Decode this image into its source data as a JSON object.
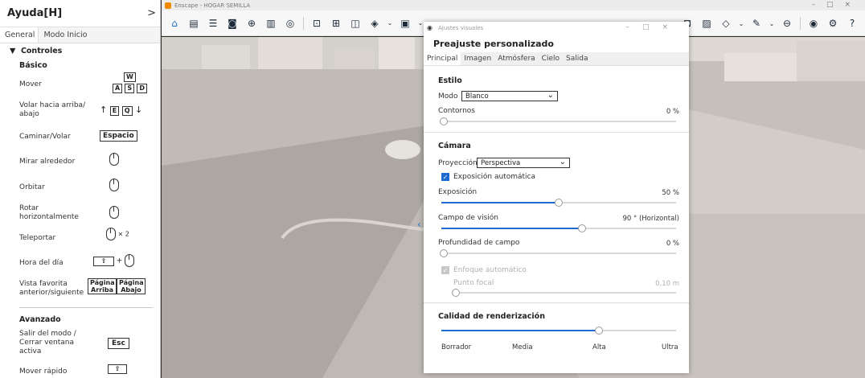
{
  "help": {
    "title": "Ayuda[H]",
    "tabs": [
      "General",
      "Modo Inicio"
    ],
    "section": "Controles",
    "basic": "Básico",
    "advanced": "Avanzado",
    "rows": [
      {
        "label": "Mover",
        "keys": [
          "W",
          "A",
          "S",
          "D"
        ]
      },
      {
        "label": "Volar hacia arriba/ abajo",
        "keys": [
          "E",
          "Q"
        ]
      },
      {
        "label": "Caminar/Volar",
        "keys": [
          "Espacio"
        ]
      },
      {
        "label": "Mirar alrededor"
      },
      {
        "label": "Orbitar"
      },
      {
        "label": "Rotar horizontalmente"
      },
      {
        "label": "Teleportar",
        "suffix": "× 2"
      },
      {
        "label": "Hora del día"
      },
      {
        "label": "Vista favorita anterior/siguiente",
        "keys": [
          "Página Arriba",
          "Página Abajo"
        ]
      },
      {
        "label": "Salir del modo / Cerrar ventana activa",
        "keys": [
          "Esc"
        ]
      },
      {
        "label": "Mover rápido"
      }
    ]
  },
  "window": {
    "title": "Enscape - HOGAR SEMILLA"
  },
  "dialog": {
    "title": "Ajustes visuales",
    "preset": "Preajuste personalizado",
    "tabs": [
      "Principal",
      "Imagen",
      "Atmósfera",
      "Cielo",
      "Salida"
    ],
    "style": {
      "heading": "Estilo",
      "mode_label": "Modo",
      "mode_value": "Blanco",
      "outlines_label": "Contornos",
      "outlines_value": "0 %",
      "outlines": 0
    },
    "camera": {
      "heading": "Cámara",
      "projection_label": "Proyección",
      "projection_value": "Perspectiva",
      "auto_exposure": "Exposición automática",
      "exposure_label": "Exposición",
      "exposure_value": "50 %",
      "exposure": 0.5,
      "fov_label": "Campo de visión",
      "fov_value": "90 ° (Horizontal)",
      "fov": 0.6,
      "dof_label": "Profundidad de campo",
      "dof_value": "0 %",
      "dof": 0,
      "auto_focus": "Enfoque automático",
      "focal_label": "Punto focal",
      "focal_value": "0,10 m",
      "focal": 0
    },
    "quality": {
      "heading": "Calidad de renderización",
      "level": 0.67,
      "labels": [
        "Borrador",
        "Media",
        "Alta",
        "Ultra"
      ]
    }
  },
  "colors": {
    "accent": "#1e6ccf",
    "brand": "#f28a00"
  }
}
